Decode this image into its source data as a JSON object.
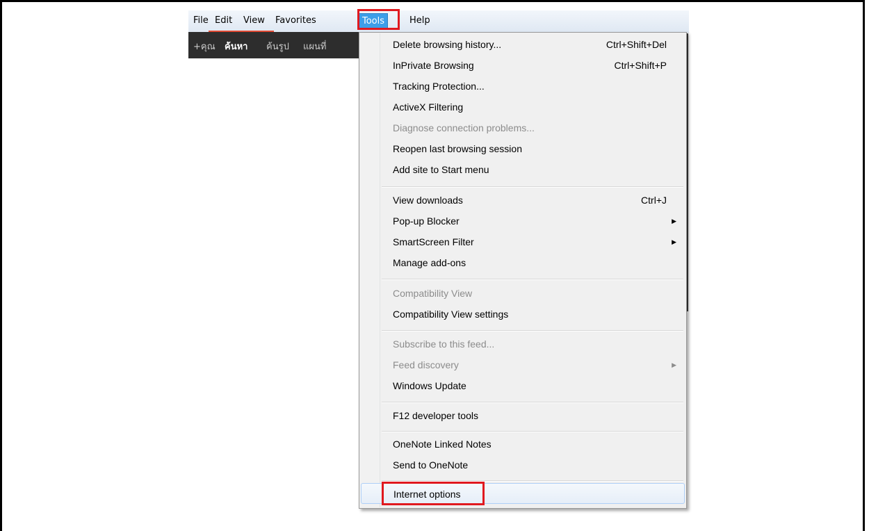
{
  "menubar": {
    "items": [
      "File",
      "Edit",
      "View",
      "Favorites",
      "Tools",
      "Help"
    ],
    "active": "Tools"
  },
  "google_bar": {
    "items": [
      "+คุณ",
      "ค้นหา",
      "ค้นรูป",
      "แผนที่"
    ]
  },
  "tools_menu": {
    "items": [
      {
        "label": "Delete browsing history...",
        "shortcut": "Ctrl+Shift+Del",
        "enabled": true
      },
      {
        "label": "InPrivate Browsing",
        "shortcut": "Ctrl+Shift+P",
        "enabled": true
      },
      {
        "label": "Tracking Protection...",
        "enabled": true
      },
      {
        "label": "ActiveX Filtering",
        "enabled": true
      },
      {
        "label": "Diagnose connection problems...",
        "enabled": false
      },
      {
        "label": "Reopen last browsing session",
        "enabled": true
      },
      {
        "label": "Add site to Start menu",
        "enabled": true
      },
      {
        "label": "View downloads",
        "shortcut": "Ctrl+J",
        "enabled": true
      },
      {
        "label": "Pop-up Blocker",
        "submenu": true,
        "enabled": true
      },
      {
        "label": "SmartScreen Filter",
        "submenu": true,
        "enabled": true
      },
      {
        "label": "Manage add-ons",
        "enabled": true
      },
      {
        "label": "Compatibility View",
        "enabled": false
      },
      {
        "label": "Compatibility View settings",
        "enabled": true
      },
      {
        "label": "Subscribe to this feed...",
        "enabled": false
      },
      {
        "label": "Feed discovery",
        "submenu": true,
        "enabled": false
      },
      {
        "label": "Windows Update",
        "enabled": true
      },
      {
        "label": "F12 developer tools",
        "enabled": true
      },
      {
        "label": "OneNote Linked Notes",
        "enabled": true
      },
      {
        "label": "Send to OneNote",
        "enabled": true
      },
      {
        "label": "Internet options",
        "enabled": true,
        "hovered": true
      }
    ]
  },
  "colors": {
    "highlight_box": "#e0191f",
    "active_menu_bg": "#3d9ee9"
  }
}
